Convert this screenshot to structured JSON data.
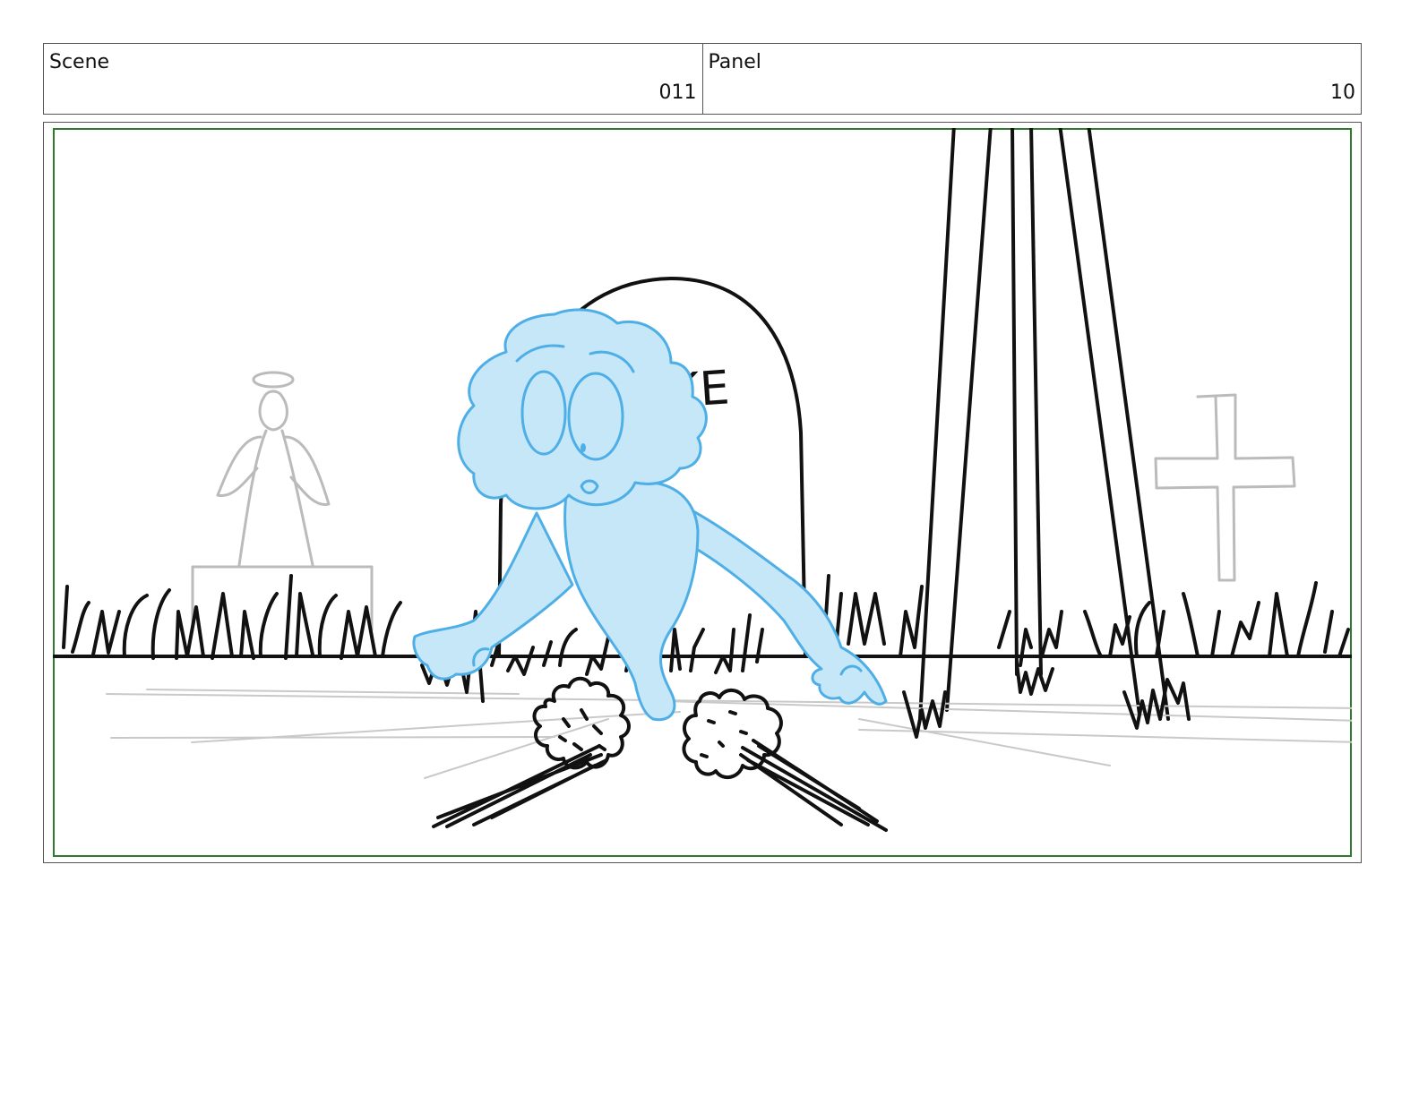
{
  "header": {
    "scene_label": "Scene",
    "scene_value": "011",
    "panel_label": "Panel",
    "panel_value": "10"
  },
  "artwork": {
    "tombstone_text": "KE",
    "colors": {
      "safe_frame": "#2e7a2e",
      "ghost_fill": "#c6e7f8",
      "ghost_line": "#4eaee6",
      "ink": "#111111",
      "background_props": "#bbbbbb"
    }
  }
}
